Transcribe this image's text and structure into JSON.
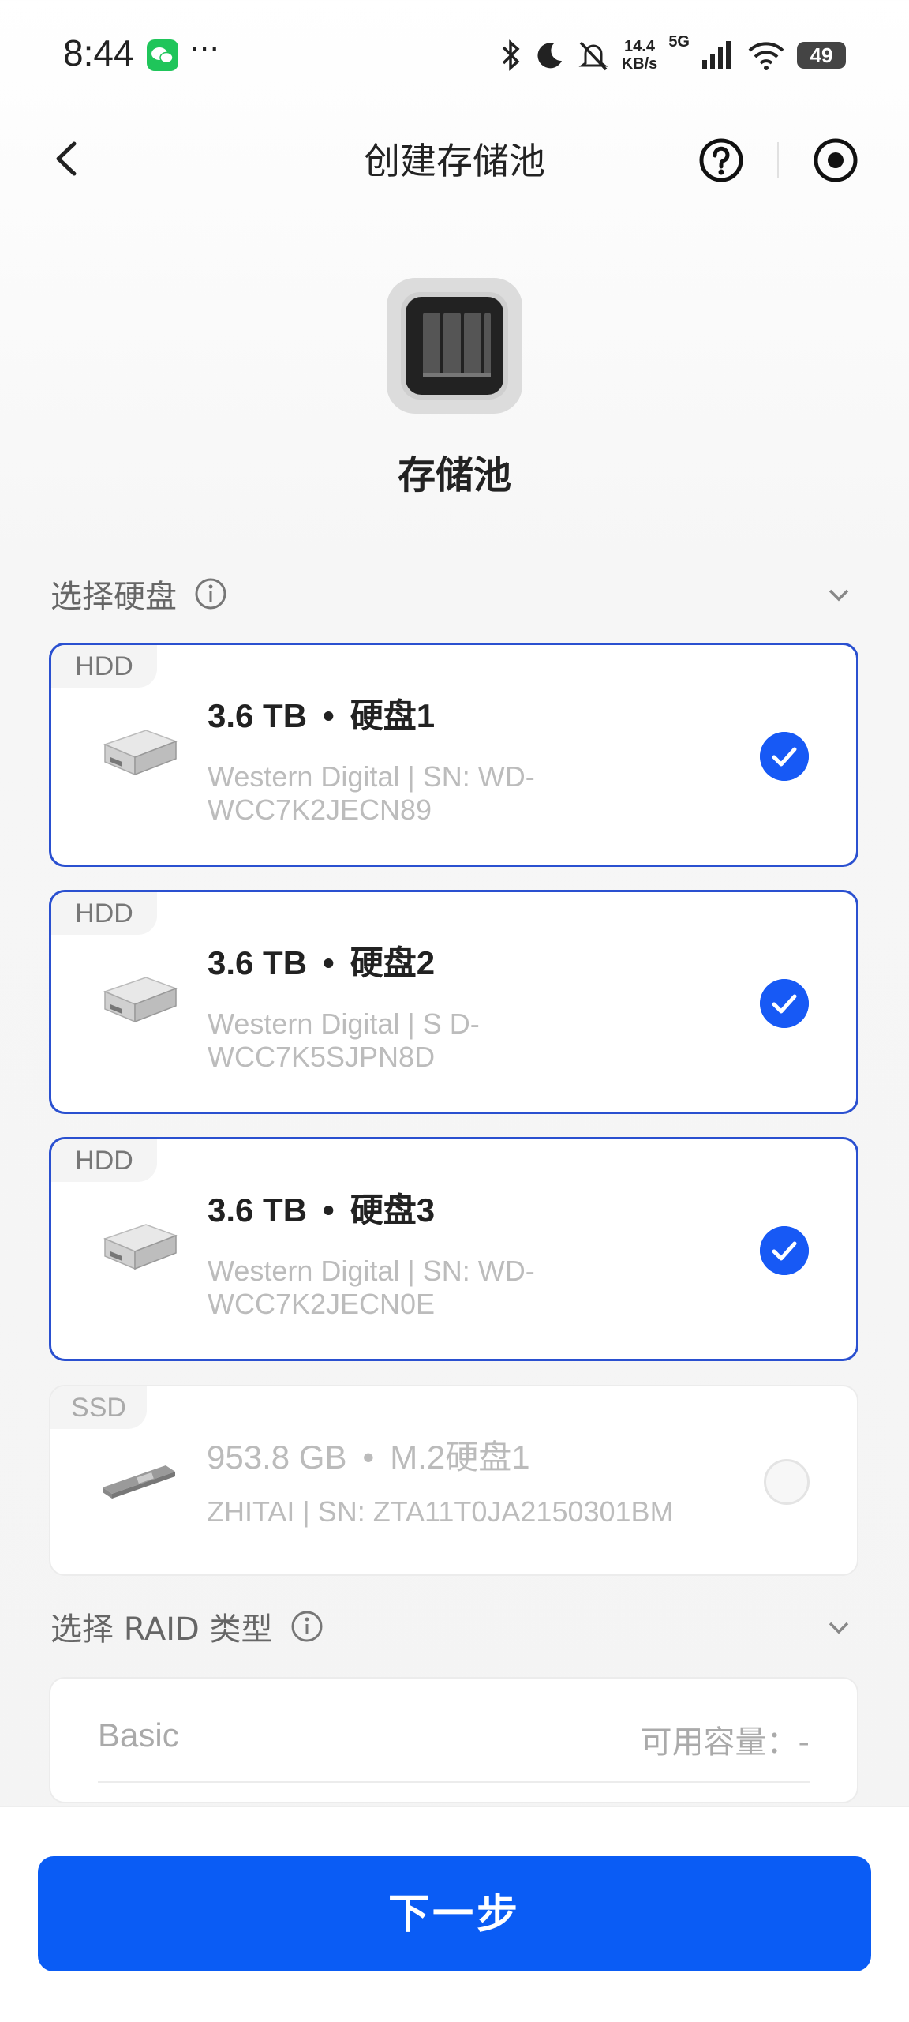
{
  "status_bar": {
    "time": "8:44",
    "dots": "···",
    "net_speed_value": "14.4",
    "net_speed_unit": "KB/s",
    "network_type": "5G",
    "battery": "49",
    "icons": [
      "wechat-icon",
      "bluetooth-icon",
      "moon-icon",
      "mute-icon",
      "signal-icon",
      "wifi-icon",
      "battery-icon"
    ]
  },
  "nav": {
    "title": "创建存储池"
  },
  "header": {
    "pool_label": "存储池"
  },
  "disk_section": {
    "label": "选择硬盘"
  },
  "disks": [
    {
      "type": "HDD",
      "size": "3.6 TB",
      "name": "硬盘1",
      "subtitle": "Western Digital  |  SN: WD-WCC7K2JECN89",
      "selected": true
    },
    {
      "type": "HDD",
      "size": "3.6 TB",
      "name": "硬盘2",
      "subtitle": "Western Digital  |  S          D-WCC7K5SJPN8D",
      "selected": true
    },
    {
      "type": "HDD",
      "size": "3.6 TB",
      "name": "硬盘3",
      "subtitle": "Western Digital  |  SN: WD-WCC7K2JECN0E",
      "selected": true
    },
    {
      "type": "SSD",
      "size": "953.8 GB",
      "name": "M.2硬盘1",
      "subtitle": "ZHITAI  |  SN: ZTA11T0JA2150301BM",
      "selected": false
    }
  ],
  "raid_section": {
    "label": "选择 RAID 类型",
    "option_name": "Basic",
    "capacity_label": "可用容量：-"
  },
  "footer": {
    "next_label": "下一步"
  },
  "colors": {
    "accent": "#0a5cf5",
    "selected_border": "#2a50d0",
    "check": "#1759f5"
  }
}
